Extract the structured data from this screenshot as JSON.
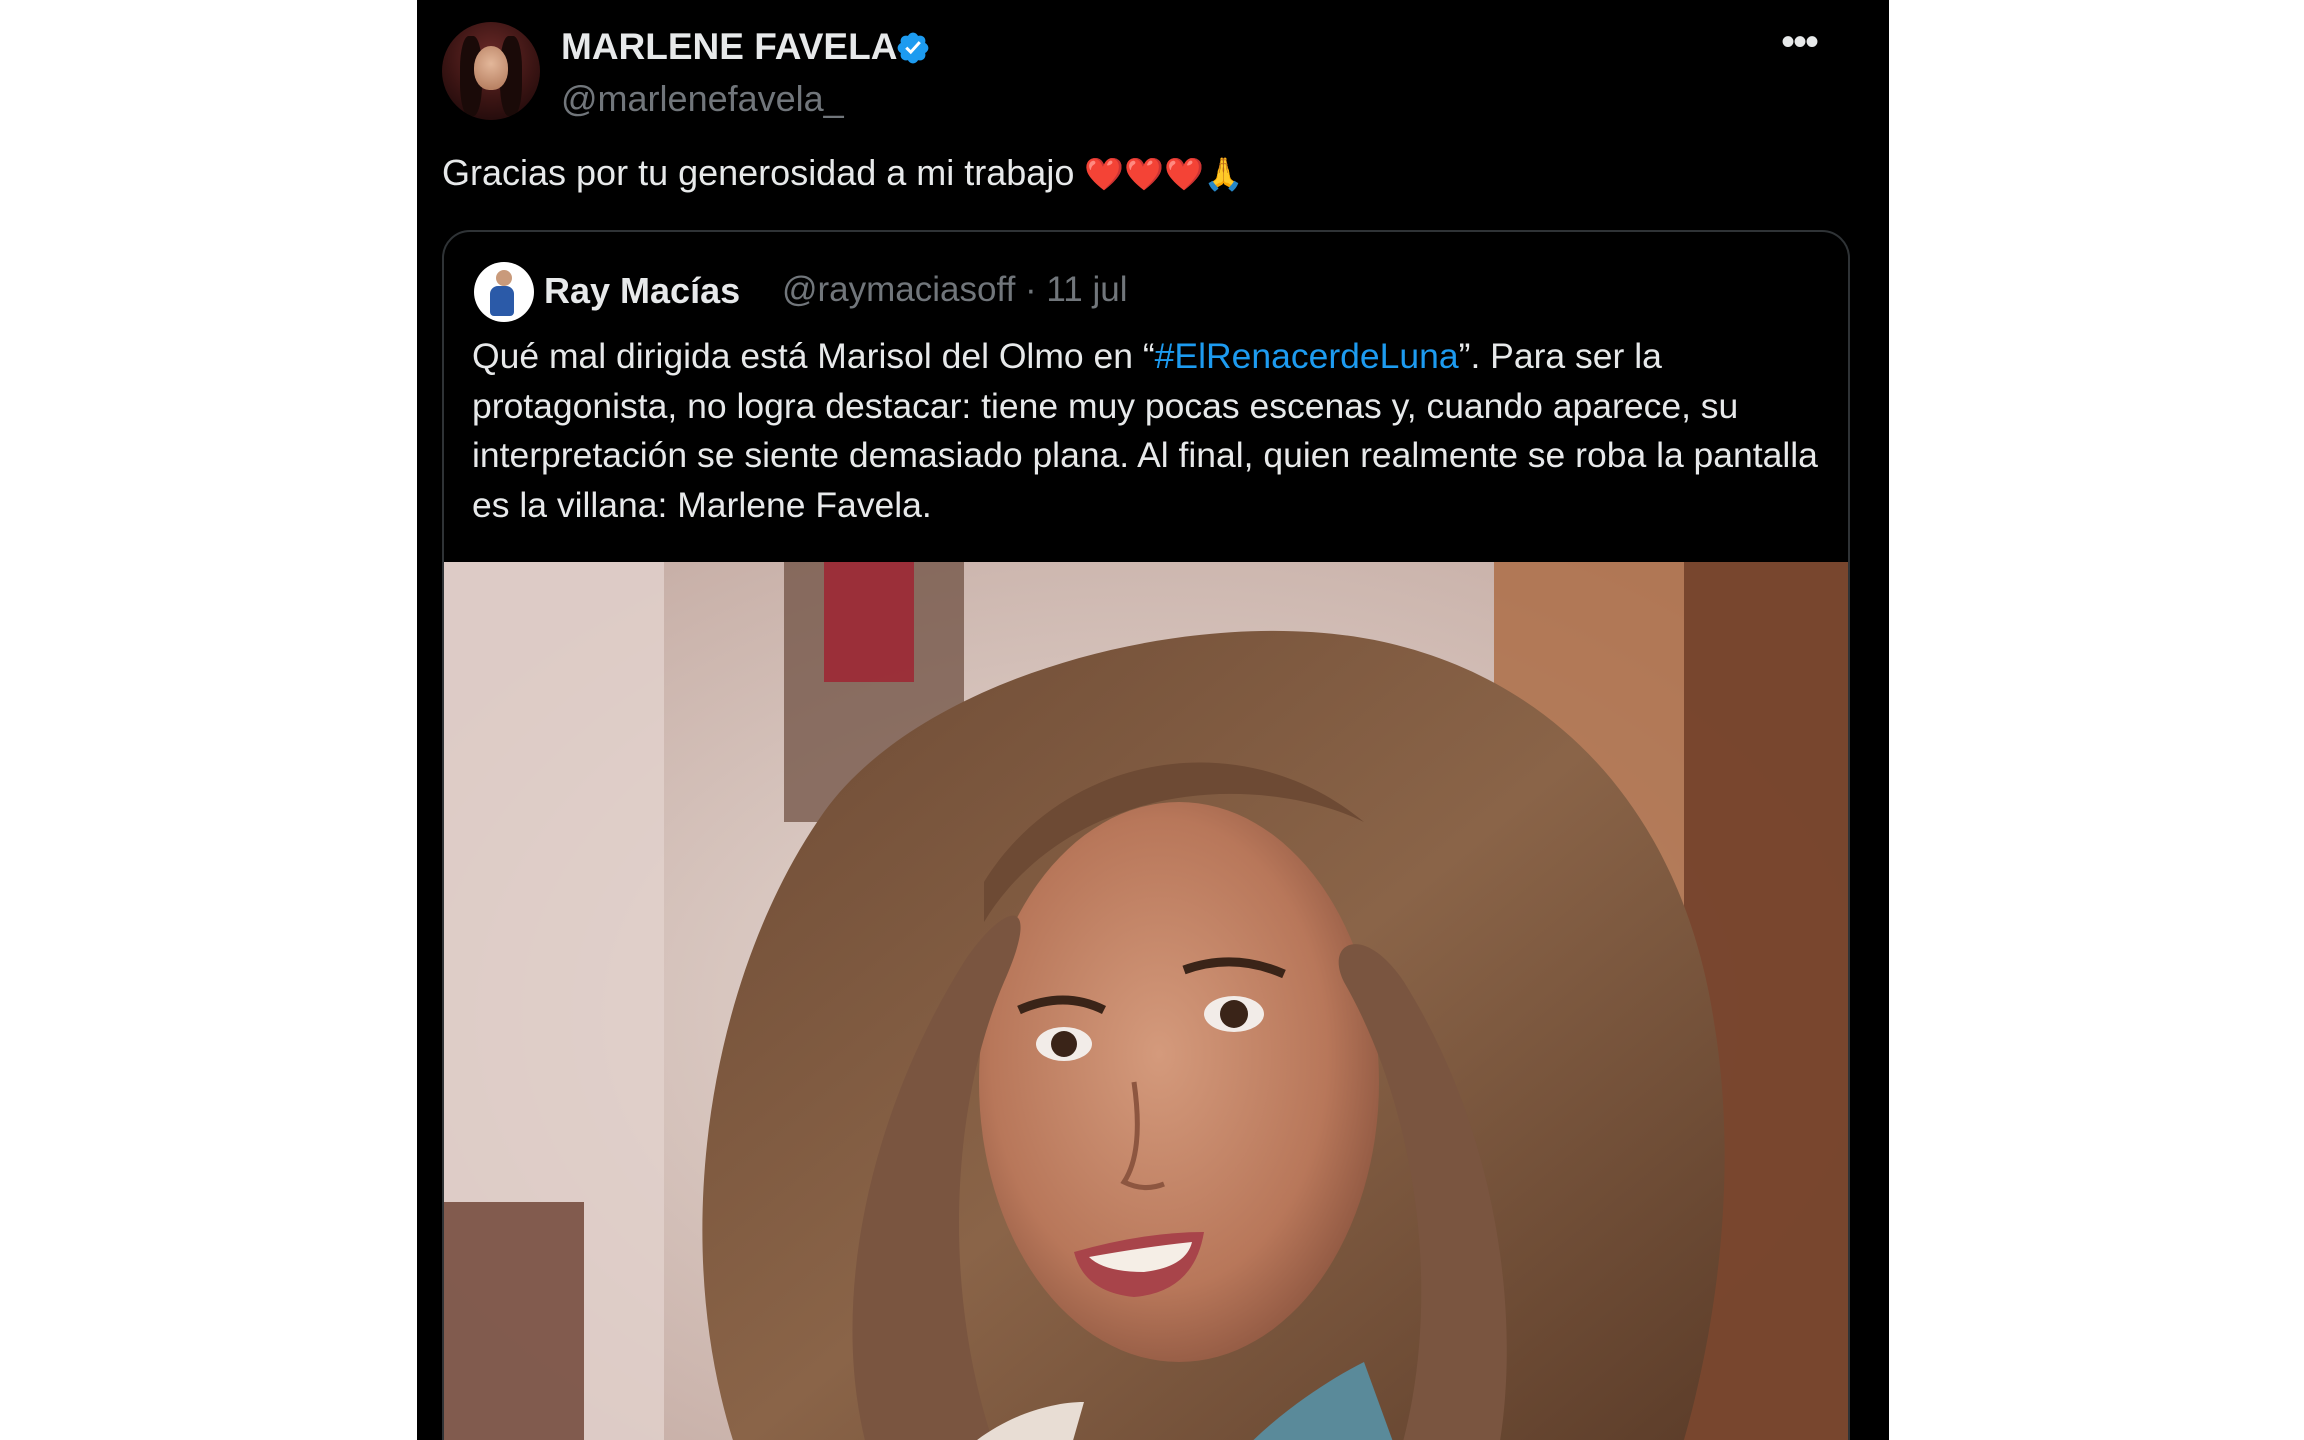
{
  "tweet": {
    "author_name": "MARLENE FAVELA",
    "author_handle": "@marlenefavela_",
    "more_label": "•••",
    "text": "Gracias por tu generosidad a mi trabajo",
    "emojis": [
      "❤️",
      "❤️",
      "❤️",
      "🙏"
    ],
    "icons": {
      "avatar": "profile-photo",
      "verified": "verified-badge-icon",
      "more": "more-options-icon"
    },
    "colors": {
      "background": "#000000",
      "text": "#e7e9ea",
      "secondary": "#71767b",
      "verified": "#1d9bf0"
    }
  },
  "quoted_tweet": {
    "author_name": "Ray Macías",
    "author_handle": "@raymaciasoff",
    "separator": "·",
    "date": "11 jul",
    "text_before": "Qué mal dirigida está Marisol del Olmo en “",
    "hashtag": "#ElRenacerdeLuna",
    "text_after": "”. Para ser la protagonista, no logra destacar: tiene muy pocas escenas y, cuando aparece, su interpretación se siente demasiado plana. Al final, quien realmente se roba la pantalla es la villana: Marlene Favela.",
    "image": "photo-of-woman-with-long-brown-hair",
    "colors": {
      "hashtag": "#1d9bf0",
      "border": "#2f3336"
    }
  }
}
